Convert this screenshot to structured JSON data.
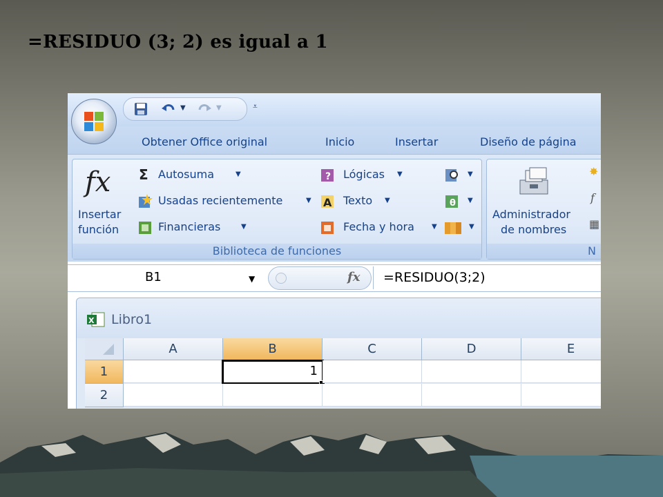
{
  "slide": {
    "title": "=RESIDUO (3; 2) es igual a 1"
  },
  "ribbon_tabs": [
    "Obtener Office original",
    "Inicio",
    "Insertar",
    "Diseño de página"
  ],
  "ribbon": {
    "insert_function": {
      "line1": "Insertar",
      "line2": "función"
    },
    "library_items": {
      "autosuma": "Autosuma",
      "usadas": "Usadas recientemente",
      "financieras": "Financieras",
      "logicas": "Lógicas",
      "texto": "Texto",
      "fecha": "Fecha y hora"
    },
    "group_label": "Biblioteca de funciones",
    "name_manager": {
      "line1": "Administrador",
      "line2": "de nombres"
    },
    "next_group_label_partial": "N"
  },
  "formula_bar": {
    "name_box": "B1",
    "fx_label": "fx",
    "formula": "=RESIDUO(3;2)"
  },
  "workbook": {
    "name": "Libro1",
    "columns": [
      "A",
      "B",
      "C",
      "D",
      "E"
    ],
    "rows": [
      "1",
      "2"
    ],
    "cell_b1": "1"
  },
  "colors": {
    "ribbon_text": "#15428b",
    "selected_header": "#f1b75d",
    "group_border": "#a4bcdc"
  }
}
